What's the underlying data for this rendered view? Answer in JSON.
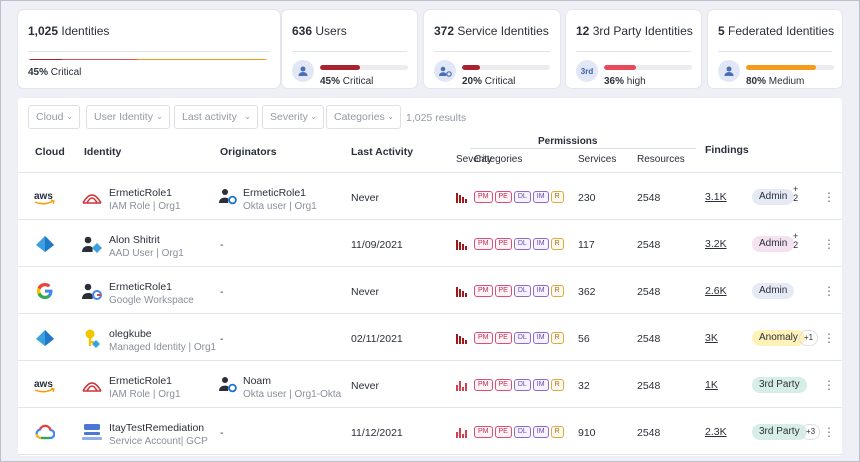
{
  "cards": [
    {
      "count": "1,025",
      "label": "Identities",
      "pct": "45%",
      "level": "Critical",
      "fraction": 0.45
    },
    {
      "count": "636",
      "label": "Users",
      "pct": "45%",
      "level": "Critical",
      "fraction": 0.45
    },
    {
      "count": "372",
      "label": "Service Identities",
      "pct": "20%",
      "level": "Critical",
      "fraction": 0.2
    },
    {
      "count": "12",
      "label": "3rd Party Identities",
      "pct": "36%",
      "level": "high",
      "fraction": 0.36,
      "icon_text": "3rd"
    },
    {
      "count": "5",
      "label": "Federated Identities",
      "pct": "80%",
      "level": "Medium",
      "fraction": 0.8
    }
  ],
  "colors": {
    "critical": "#a8232d",
    "high": "#e84a5a",
    "medium": "#f59a1b",
    "card_track": "#ececf0"
  },
  "filters": [
    "Cloud",
    "User Identity",
    "Last activity",
    "Severity",
    "Categories"
  ],
  "results_text": "1,025 results",
  "columns": {
    "cloud": "Cloud",
    "identity": "Identity",
    "originators": "Originators",
    "last_activity": "Last Activity",
    "permissions": "Permissions",
    "severity": "Severity",
    "categories": "Categories",
    "services": "Services",
    "resources": "Resources",
    "findings": "Findings"
  },
  "category_tags": [
    "PM",
    "PE",
    "DL",
    "IM",
    "R"
  ],
  "rows": [
    {
      "cloud_icon": "aws-logo",
      "identity_icon": "iam-role-icon",
      "name": "ErmeticRole1",
      "sub": "IAM Role | Org1",
      "originator": {
        "name": "ErmeticRole1",
        "sub": "Okta user | Org1"
      },
      "last_activity": "Never",
      "services": "230",
      "resources": "2548",
      "findings": "3.1K",
      "badge": "Admin",
      "badge_kind": "b-admin",
      "extra": "+\n2"
    },
    {
      "cloud_icon": "azure-logo",
      "identity_icon": "aad-user-icon",
      "name": "Alon Shitrit",
      "sub": "AAD User  | Org1",
      "originator": null,
      "last_activity": "11/09/2021",
      "services": "117",
      "resources": "2548",
      "findings": "3.2K",
      "badge": "Admin",
      "badge_kind": "b-admin2",
      "extra": "+\n2"
    },
    {
      "cloud_icon": "google-logo",
      "identity_icon": "google-workspace-user-icon",
      "name": "ErmeticRole1",
      "sub": "Google Workspace",
      "originator": null,
      "last_activity": "Never",
      "services": "362",
      "resources": "2548",
      "findings": "2.6K",
      "badge": "Admin",
      "badge_kind": "b-admin",
      "extra": ""
    },
    {
      "cloud_icon": "azure-logo",
      "identity_icon": "managed-identity-key-icon",
      "name": "olegkube",
      "sub": "Managed Identity | Org1",
      "originator": null,
      "last_activity": "02/11/2021",
      "services": "56",
      "resources": "2548",
      "findings": "3K",
      "badge": "Anomaly",
      "badge_kind": "b-anom",
      "extra": "+1"
    },
    {
      "cloud_icon": "aws-logo",
      "identity_icon": "iam-role-icon",
      "name": "ErmeticRole1",
      "sub": "IAM Role | Org1",
      "originator": {
        "name": "Noam",
        "sub": "Okta user | Org1-Okta"
      },
      "last_activity": "Never",
      "services": "32",
      "resources": "2548",
      "findings": "1K",
      "badge": "3rd Party",
      "badge_kind": "b-3p",
      "extra": ""
    },
    {
      "cloud_icon": "gcp-logo",
      "identity_icon": "service-account-icon",
      "name": "ItayTestRemediation",
      "sub": "Service Account| GCP",
      "originator": null,
      "last_activity": "11/12/2021",
      "services": "910",
      "resources": "2548",
      "findings": "2.3K",
      "badge": "3rd Party",
      "badge_kind": "b-3p",
      "extra": "+3"
    }
  ],
  "dash": "-"
}
